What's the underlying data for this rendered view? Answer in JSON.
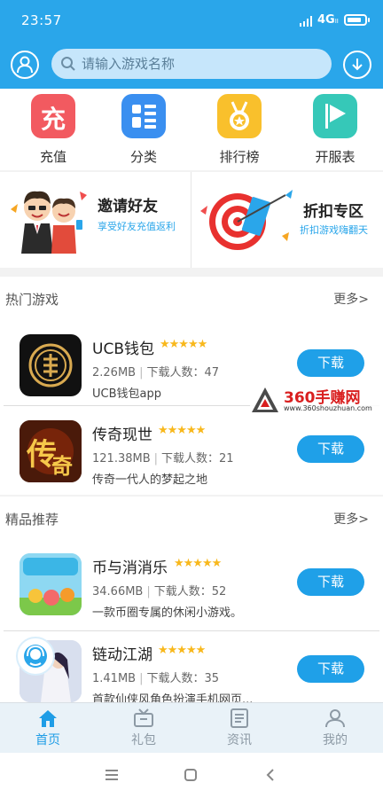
{
  "status_bar": {
    "time": "23:57",
    "network": "4G",
    "network_sub": "II"
  },
  "search": {
    "placeholder": "请输入游戏名称"
  },
  "quick_nav": [
    {
      "label": "充值",
      "icon": "recharge-icon",
      "glyph": "充",
      "color": "#f25a60"
    },
    {
      "label": "分类",
      "icon": "category-icon",
      "color": "#3a8ff0"
    },
    {
      "label": "排行榜",
      "icon": "ranking-medal-icon",
      "color": "#f9c02c"
    },
    {
      "label": "开服表",
      "icon": "server-flag-icon",
      "color": "#36c8b8"
    }
  ],
  "banners": [
    {
      "title": "邀请好友",
      "subtitle": "享受好友充值返利"
    },
    {
      "title": "折扣专区",
      "subtitle": "折扣游戏嗨翻天"
    }
  ],
  "hot_games": {
    "title": "热门游戏",
    "more": "更多>",
    "items": [
      {
        "name": "UCB钱包",
        "stars": "★★★★★",
        "size": "2.26MB",
        "downloads": "下载人数：47",
        "desc": "UCB钱包app",
        "button": "下载"
      },
      {
        "name": "传奇现世",
        "stars": "★★★★★",
        "size": "121.38MB",
        "downloads": "下载人数：21",
        "desc": "传奇一代人的梦起之地",
        "button": "下载"
      }
    ]
  },
  "recommended": {
    "title": "精品推荐",
    "more": "更多>",
    "items": [
      {
        "name": "币与消消乐",
        "stars": "★★★★★",
        "size": "34.66MB",
        "downloads": "下载人数：52",
        "desc": "一款币圈专属的休闲小游戏。",
        "button": "下载"
      },
      {
        "name": "链动江湖",
        "stars": "★★★★★",
        "size": "1.41MB",
        "downloads": "下载人数：35",
        "desc": "首款仙侠风角色扮演手机网页...",
        "button": "下载"
      }
    ]
  },
  "watermark": {
    "title": "360手赚网",
    "url": "www.360shouzhuan.com"
  },
  "tabs": [
    {
      "label": "首页",
      "icon": "home-icon",
      "active": true
    },
    {
      "label": "礼包",
      "icon": "gift-tv-icon",
      "active": false
    },
    {
      "label": "资讯",
      "icon": "news-icon",
      "active": false
    },
    {
      "label": "我的",
      "icon": "profile-icon",
      "active": false
    }
  ],
  "colors": {
    "primary": "#2aa6ea",
    "button": "#1fa0e8",
    "star": "#f8b81c",
    "tab_active": "#1f9de6"
  }
}
